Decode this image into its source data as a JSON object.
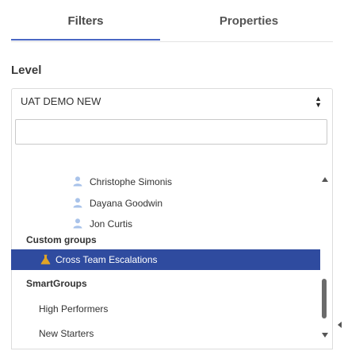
{
  "tabs": [
    {
      "label": "Filters"
    },
    {
      "label": "Properties"
    }
  ],
  "level": {
    "label": "Level",
    "selected_value": "UAT DEMO NEW"
  },
  "search": {
    "value": "",
    "placeholder": ""
  },
  "users": [
    {
      "name": "Christophe Simonis",
      "icon": "user-icon"
    },
    {
      "name": "Dayana Goodwin",
      "icon": "user-icon"
    },
    {
      "name": "Jon Curtis",
      "icon": "user-icon"
    }
  ],
  "custom_groups": {
    "header": "Custom groups",
    "items": [
      {
        "label": "Cross Team Escalations",
        "icon": "flask-icon",
        "selected": true
      }
    ]
  },
  "smart_groups": {
    "header": "SmartGroups",
    "items": [
      {
        "label": "High Performers"
      },
      {
        "label": "New Starters"
      }
    ]
  },
  "colors": {
    "accent": "#4a67c4",
    "selected_bg": "#2f4b9f",
    "user_icon": "#a9c3ea",
    "flask_icon": "#e0a426"
  }
}
